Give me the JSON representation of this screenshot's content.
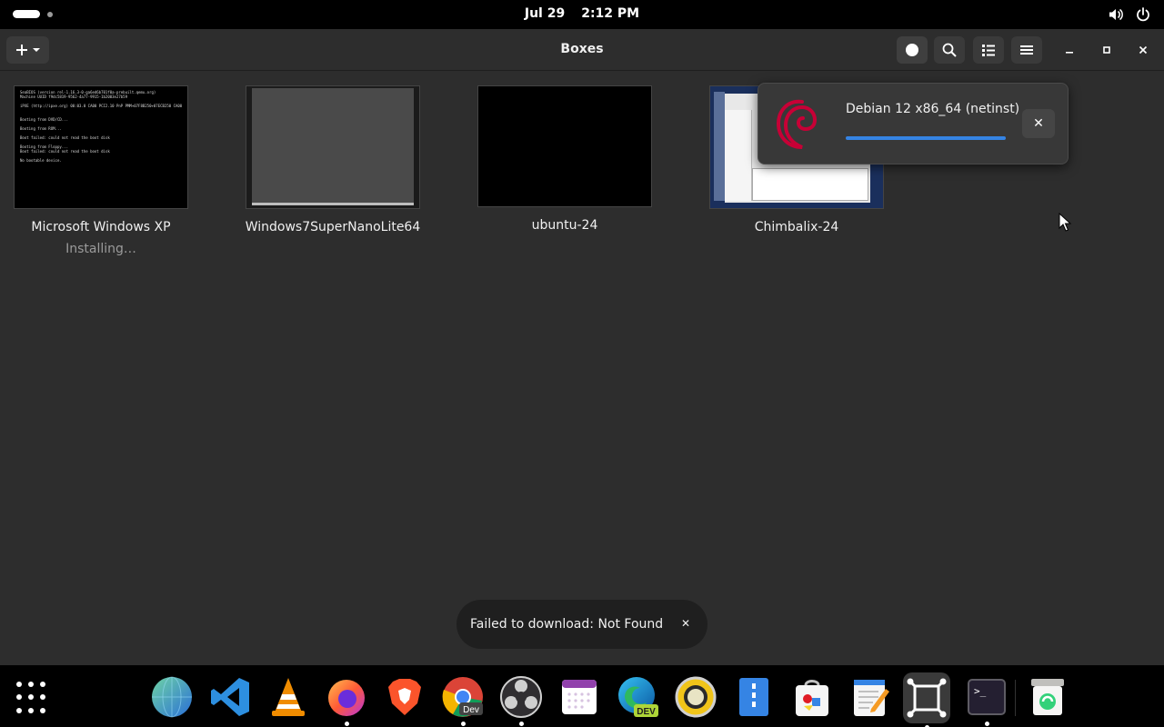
{
  "topbar": {
    "date": "Jul 29",
    "time": "2:12 PM",
    "icons": [
      "volume-icon",
      "power-icon"
    ]
  },
  "window": {
    "title": "Boxes",
    "header_icons": [
      "add-icon",
      "chevron-down-icon",
      "downloads-indicator-icon",
      "search-icon",
      "list-view-icon",
      "menu-icon",
      "minimize-icon",
      "maximize-icon",
      "close-icon"
    ]
  },
  "boxes": [
    {
      "name": "Microsoft Windows XP",
      "status": "Installing…",
      "console": "SeaBIOS (version rel-1.16.3-0-ga6ed6b701f0a-prebuilt.qemu.org)\nMachine UUID f9dc5819-9562-4a77-9915-1b2003e27b59\n\niPXE (http://ipxe.org) 00:03.0 CA00 PCI2.10 PnP PMM+07F8B250+07ECB250 CA00\n\n\nBooting from DVD/CD...\n\nBooting from ROM...\n\nBoot failed: could not read the boot disk\n\nBooting from Floppy...\nBoot failed: could not read the boot disk\n\nNo bootable device."
    },
    {
      "name": "Windows7SuperNanoLite64",
      "status": ""
    },
    {
      "name": "ubuntu-24",
      "status": ""
    },
    {
      "name": "Chimbalix-24",
      "status": ""
    }
  ],
  "download_popover": {
    "title": "Debian 12 x86_64 (netinst)",
    "progress": 1.0,
    "icon": "debian-logo-icon",
    "close_label": "✕"
  },
  "toast": {
    "message": "Failed to download: Not Found",
    "close_label": "✕"
  },
  "dock": {
    "apps": [
      {
        "name": "web-browser",
        "running": false
      },
      {
        "name": "vscode",
        "running": false
      },
      {
        "name": "vlc",
        "running": false
      },
      {
        "name": "firefox",
        "running": true
      },
      {
        "name": "brave",
        "running": false
      },
      {
        "name": "chrome-dev",
        "running": true,
        "badge": "Dev"
      },
      {
        "name": "obs-studio",
        "running": true
      },
      {
        "name": "calendar",
        "running": false
      },
      {
        "name": "edge-dev",
        "running": false,
        "badge": "DEV"
      },
      {
        "name": "audio-player",
        "running": false
      },
      {
        "name": "file-archiver",
        "running": false
      },
      {
        "name": "software-store",
        "running": false
      },
      {
        "name": "text-editor",
        "running": false
      },
      {
        "name": "boxes",
        "running": true
      },
      {
        "name": "terminal",
        "running": true,
        "prompt": ">_"
      },
      {
        "name": "trash",
        "running": false
      }
    ]
  },
  "colors": {
    "window_bg": "#2d2d2d",
    "accent": "#3584e4",
    "debian_red": "#c70036"
  }
}
